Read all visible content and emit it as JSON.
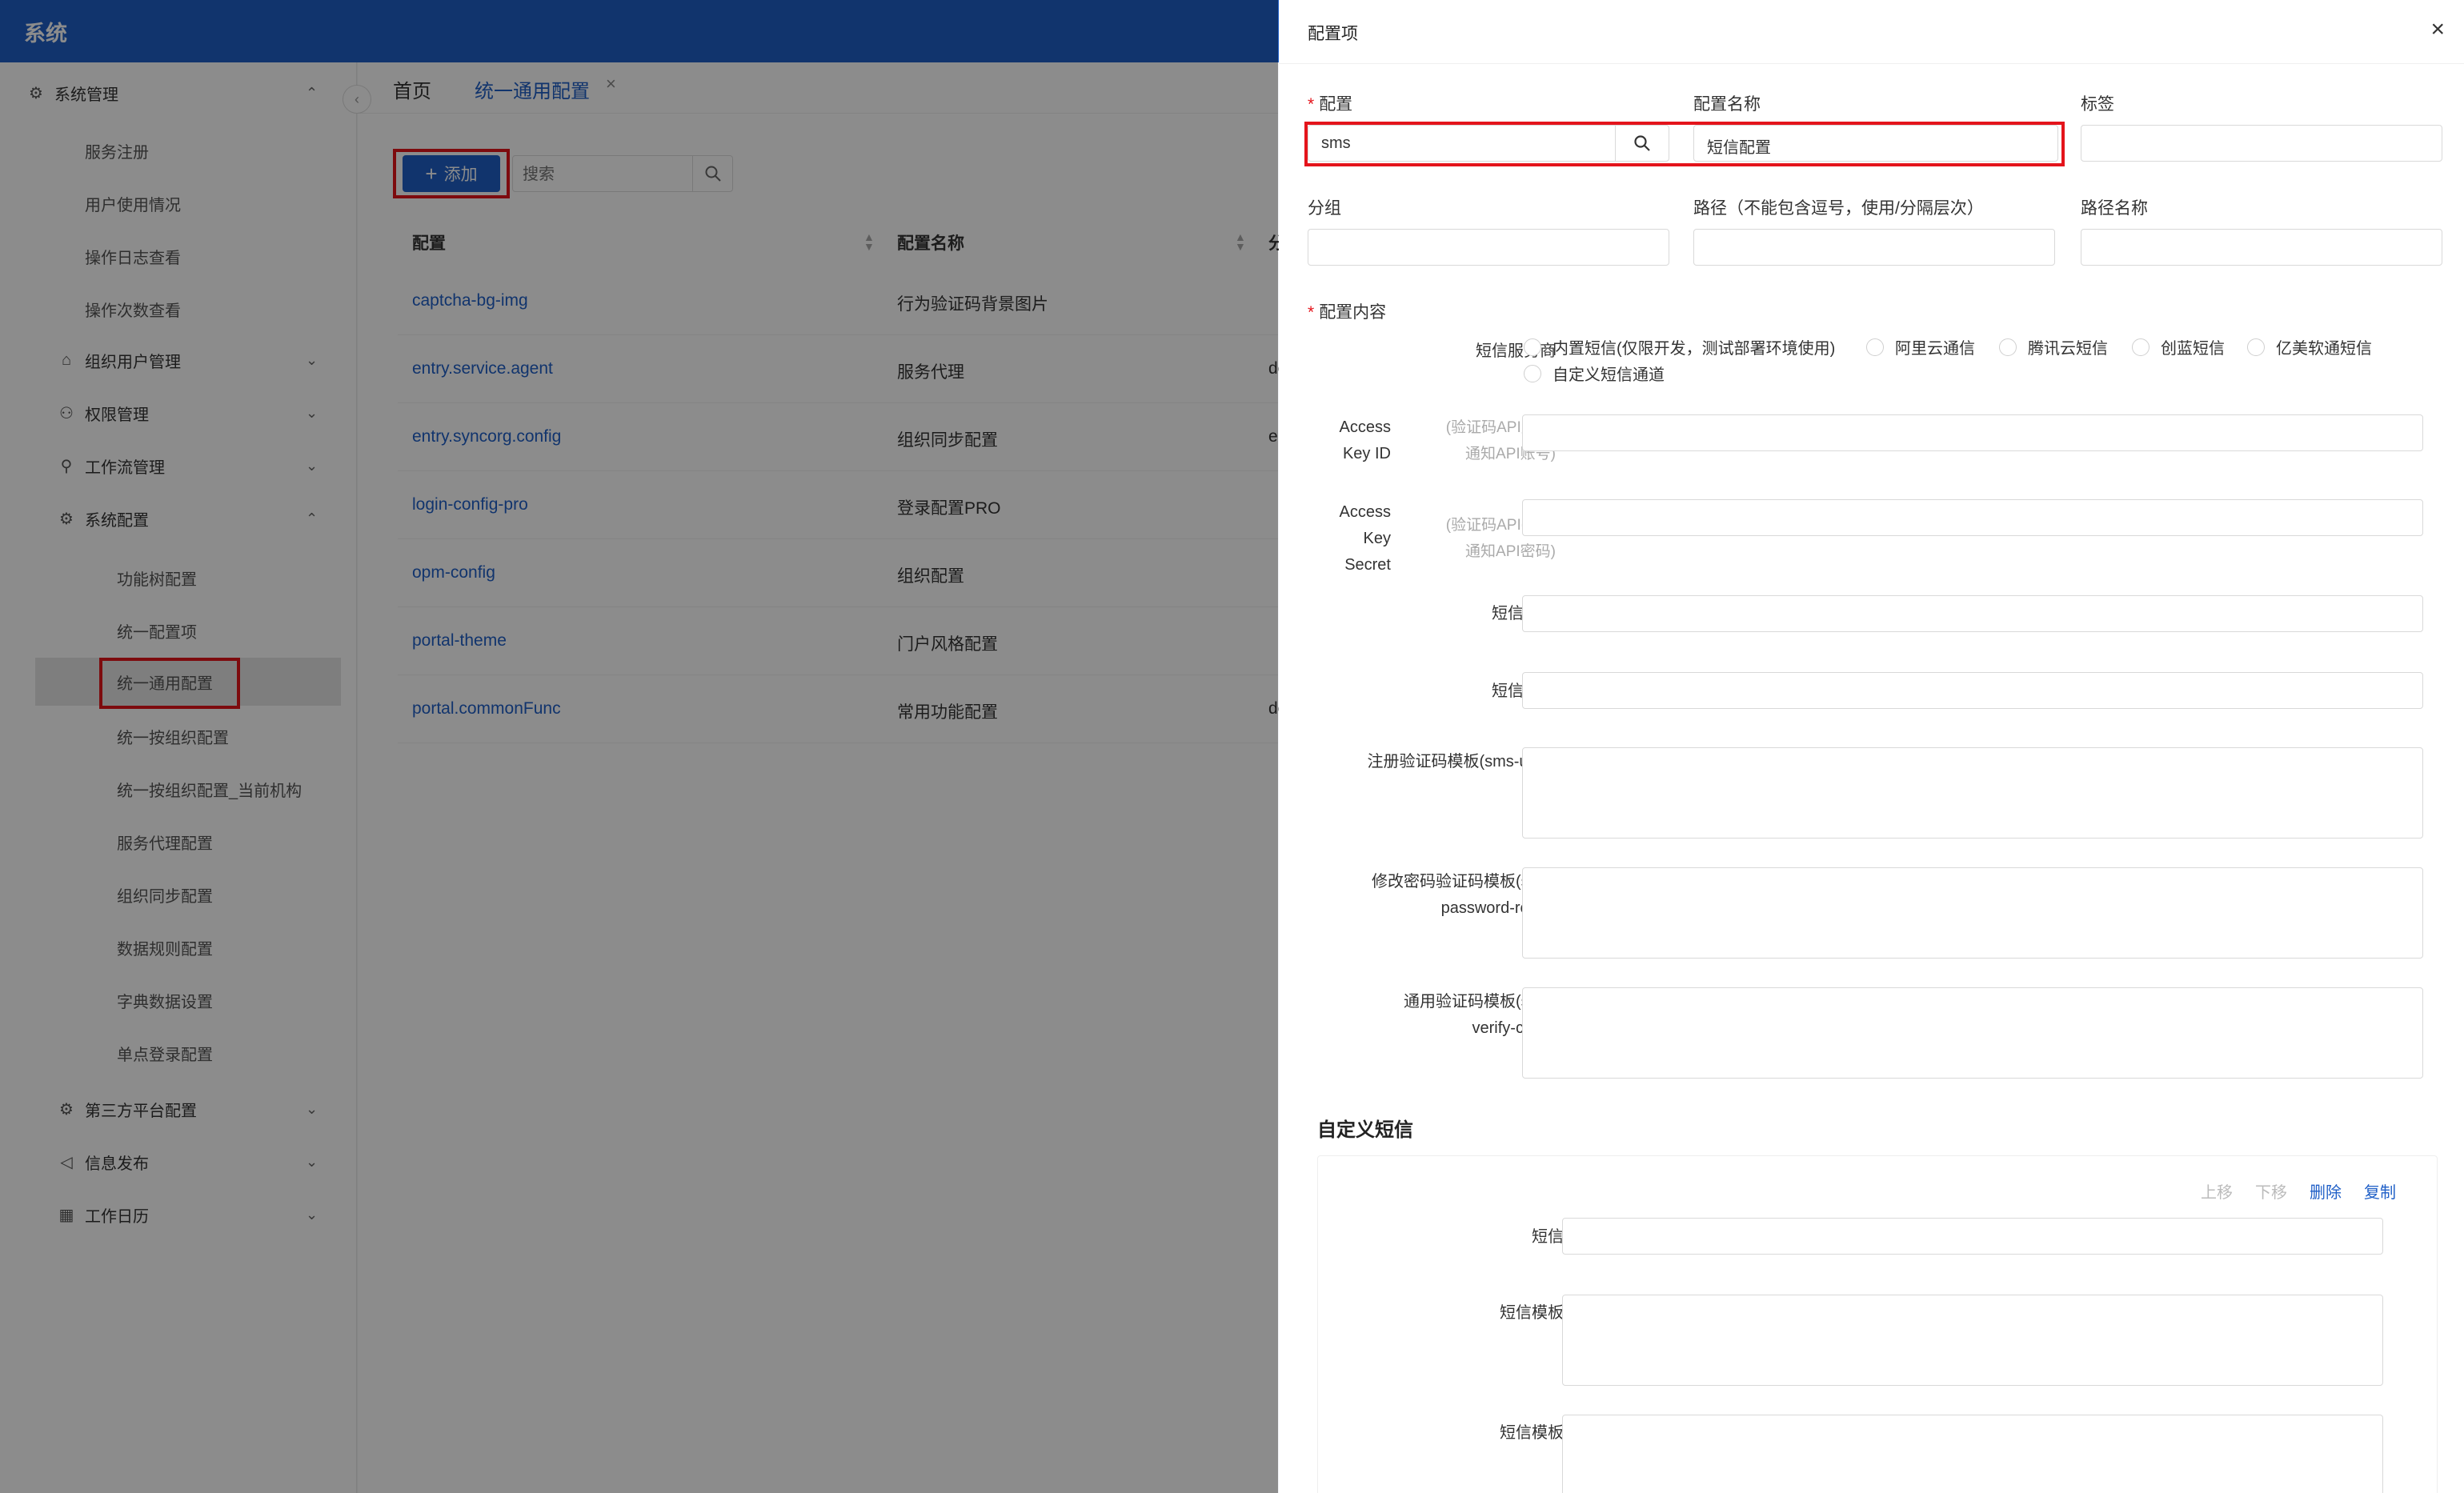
{
  "app": {
    "title": "系统"
  },
  "sidebar": {
    "groups": [
      {
        "label": "系统管理",
        "icon": "gear-icon",
        "glyph": "⚙",
        "chevron": "up"
      },
      {
        "label": "组织用户管理",
        "icon": "bank-icon",
        "glyph": "⌂",
        "chevron": "down"
      },
      {
        "label": "权限管理",
        "icon": "user-icon",
        "glyph": "⚇",
        "chevron": "down"
      },
      {
        "label": "工作流管理",
        "icon": "workflow-icon",
        "glyph": "⚲",
        "chevron": "down"
      },
      {
        "label": "系统配置",
        "icon": "gear-icon",
        "glyph": "⚙",
        "chevron": "up"
      },
      {
        "label": "第三方平台配置",
        "icon": "gear-icon",
        "glyph": "⚙",
        "chevron": "down"
      },
      {
        "label": "信息发布",
        "icon": "megaphone-icon",
        "glyph": "◁",
        "chevron": "down"
      },
      {
        "label": "工作日历",
        "icon": "calendar-icon",
        "glyph": "▦",
        "chevron": "down"
      }
    ],
    "system_mgmt_items": [
      "服务注册",
      "用户使用情况",
      "操作日志查看",
      "操作次数查看"
    ],
    "system_config_items": [
      "功能树配置",
      "统一配置项",
      "统一通用配置",
      "统一按组织配置",
      "统一按组织配置_当前机构",
      "服务代理配置",
      "组织同步配置",
      "数据规则配置",
      "字典数据设置",
      "单点登录配置"
    ],
    "active_item": "统一通用配置"
  },
  "tabs": {
    "home": "首页",
    "current": "统一通用配置",
    "close": "×"
  },
  "toolbar": {
    "add_label": "添加",
    "search_placeholder": "搜索"
  },
  "table": {
    "headers": {
      "config": "配置",
      "config_name": "配置名称",
      "group": "分"
    },
    "rows": [
      {
        "config": "captcha-bg-img",
        "name": "行为验证码背景图片",
        "extra": ""
      },
      {
        "config": "entry.service.agent",
        "name": "服务代理",
        "extra": "de"
      },
      {
        "config": "entry.syncorg.config",
        "name": "组织同步配置",
        "extra": "er"
      },
      {
        "config": "login-config-pro",
        "name": "登录配置PRO",
        "extra": ""
      },
      {
        "config": "opm-config",
        "name": "组织配置",
        "extra": ""
      },
      {
        "config": "portal-theme",
        "name": "门户风格配置",
        "extra": ""
      },
      {
        "config": "portal.commonFunc",
        "name": "常用功能配置",
        "extra": "de"
      }
    ]
  },
  "drawer": {
    "title": "配置项",
    "close": "×",
    "fields": {
      "config_label": "配置",
      "config_value": "sms",
      "config_name_label": "配置名称",
      "config_name_value": "短信配置",
      "tag_label": "标签",
      "group_label": "分组",
      "path_label": "路径（不能包含逗号，使用/分隔层次）",
      "path_name_label": "路径名称",
      "content_label": "配置内容"
    },
    "sms": {
      "provider_label": "短信服务商",
      "providers": [
        "内置短信(仅限开发，测试部署环境使用)",
        "阿里云通信",
        "腾讯云短信",
        "创蓝短信",
        "亿美软通短信",
        "自定义短信通道"
      ],
      "access_key_id_label_1": "Access",
      "access_key_id_label_2": "Key ID",
      "access_key_id_hint_1": "(验证码API账号,",
      "access_key_id_hint_2": "通知API账号)",
      "access_key_secret_label_1": "Access",
      "access_key_secret_label_2": "Key",
      "access_key_secret_label_3": "Secret",
      "access_key_secret_hint_1": "(验证码API密码,",
      "access_key_secret_hint_2": "通知API密码)",
      "sign_label": "短信签名",
      "address_label": "短信地址",
      "reg_tpl_label_1": "注册验证码模板(sms-user-",
      "reg_tpl_label_2": "reg)",
      "reset_tpl_label_1": "修改密码验证码模板(sms-",
      "reset_tpl_label_2": "password-reset)",
      "verify_tpl_label_1": "通用验证码模板(sms-",
      "verify_tpl_label_2": "verify-code)"
    },
    "custom": {
      "title": "自定义短信",
      "actions": {
        "up": "上移",
        "down": "下移",
        "delete": "删除",
        "copy": "复制"
      },
      "code_label": "短信编码",
      "template_code_label": "短信模板编码",
      "template_content_label": "短信模板内容"
    }
  },
  "colors": {
    "brand": "#1f5fc7",
    "highlight": "#e4141b",
    "required": "#e4141b",
    "link": "#1f5fc7"
  }
}
